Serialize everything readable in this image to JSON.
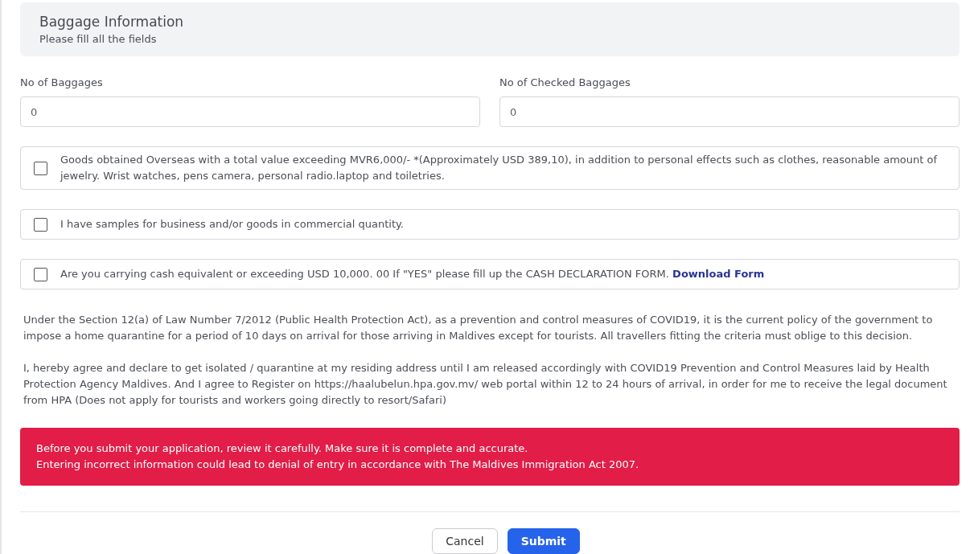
{
  "header": {
    "title": "Baggage Information",
    "subtitle": "Please fill all the fields"
  },
  "fields": [
    {
      "label": "No of Baggages",
      "value": "0"
    },
    {
      "label": "No of Checked Baggages",
      "value": "0"
    }
  ],
  "declarations": [
    {
      "text": "Goods obtained Overseas with a total value exceeding MVR6,000/- *(Approximately USD 389,10), in addition to personal effects such as clothes, reasonable amount of jewelry. Wrist watches, pens camera, personal radio.laptop and toiletries.",
      "checked": false
    },
    {
      "text": "I have samples for business and/or goods in commercial quantity.",
      "checked": false
    },
    {
      "text": "Are you carrying cash equivalent or exceeding USD 10,000. 00 If \"YES\" please fill up the CASH DECLARATION FORM.",
      "link": "Download Form",
      "checked": false
    }
  ],
  "notices": [
    "Under the Section 12(a) of Law Number 7/2012 (Public Health Protection Act), as a prevention and control measures of COVID19, it is the current policy of the government to impose a home quarantine for a period of 10 days on arrival for those arriving in Maldives except for tourists. All travellers fitting the criteria must oblige to this decision.",
    "I, hereby agree and declare to get isolated / quarantine at my residing address until I am released accordingly with COVID19 Prevention and Control Measures laid by Health Protection Agency Maldives. And I agree to Register on https://haalubelun.hpa.gov.mv/ web portal within 12 to 24 hours of arrival, in order for me to receive the legal document from HPA (Does not apply for tourists and workers going directly to resort/Safari)"
  ],
  "alert": {
    "lines": [
      "Before you submit your application, review it carefully. Make sure it is complete and accurate.",
      "Entering incorrect information could lead to denial of entry in accordance with The Maldives Immigration Act 2007."
    ]
  },
  "buttons": [
    {
      "label": "Cancel",
      "kind": "secondary"
    },
    {
      "label": "Submit",
      "kind": "primary"
    }
  ]
}
